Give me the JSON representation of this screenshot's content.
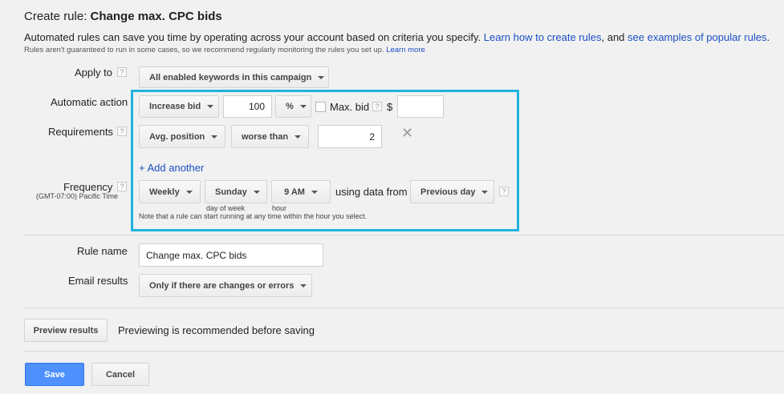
{
  "header": {
    "title_prefix": "Create rule: ",
    "title_rule": "Change max. CPC bids",
    "description_main": "Automated rules can save you time by operating across your account based on criteria you specify. ",
    "description_link1": "Learn how to create rules",
    "description_mid": ", and ",
    "description_link2": "see examples of popular rules",
    "description_end": ".",
    "note_text": "Rules aren't guaranteed to run in some cases, so we recommend regularly monitoring the rules you set up. ",
    "note_link": "Learn more"
  },
  "apply_to": {
    "label": "Apply to",
    "help": "?",
    "value": "All enabled keywords in this campaign"
  },
  "automatic_action": {
    "label": "Automatic action",
    "action": "Increase bid",
    "amount": "100",
    "unit": "%",
    "max_bid_label": "Max. bid",
    "help": "?",
    "currency": "$",
    "max_bid_value": ""
  },
  "requirements": {
    "label": "Requirements",
    "help": "?",
    "metric": "Avg. position",
    "operator": "worse than",
    "value": "2",
    "remove_icon": "close-icon",
    "add_another": "+ Add another"
  },
  "frequency": {
    "label": "Frequency",
    "help": "?",
    "timezone": "(GMT-07:00) Pacific Time",
    "period": "Weekly",
    "day": "Sunday",
    "hour": "9 AM",
    "using_data_from": "using data from",
    "data_range": "Previous day",
    "day_caption": "day of week",
    "hour_caption": "hour",
    "note": "Note that a rule can start running at any time within the hour you select."
  },
  "rule_name": {
    "label": "Rule name",
    "value": "Change max. CPC bids"
  },
  "email_results": {
    "label": "Email results",
    "value": "Only if there are changes or errors"
  },
  "preview": {
    "button": "Preview results",
    "text": "Previewing is recommended before saving"
  },
  "actions": {
    "save": "Save",
    "cancel": "Cancel"
  },
  "colors": {
    "highlight": "#1fb2de",
    "link": "#1a4fc3",
    "save_button": "#4d90fe"
  }
}
